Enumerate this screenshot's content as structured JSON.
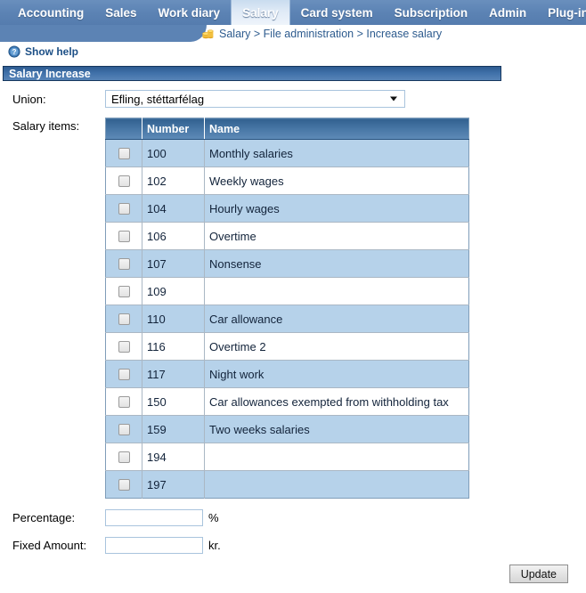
{
  "nav": {
    "items": [
      {
        "label": "Accounting",
        "active": false
      },
      {
        "label": "Sales",
        "active": false
      },
      {
        "label": "Work diary",
        "active": false
      },
      {
        "label": "Salary",
        "active": true
      },
      {
        "label": "Card system",
        "active": false
      },
      {
        "label": "Subscription",
        "active": false
      },
      {
        "label": "Admin",
        "active": false
      },
      {
        "label": "Plug-ins",
        "active": false
      }
    ]
  },
  "breadcrumb": {
    "icon": "coin-stack-icon",
    "text": "Salary > File administration > Increase salary"
  },
  "help": {
    "icon": "question-mark-icon",
    "label": "Show help"
  },
  "panel": {
    "title": "Salary Increase"
  },
  "union": {
    "label": "Union:",
    "selected": "Efling, stéttarfélag"
  },
  "salary_items": {
    "label": "Salary items:",
    "columns": [
      "",
      "Number",
      "Name"
    ],
    "rows": [
      {
        "number": "100",
        "name": "Monthly salaries",
        "checked": false
      },
      {
        "number": "102",
        "name": "Weekly wages",
        "checked": false
      },
      {
        "number": "104",
        "name": "Hourly wages",
        "checked": false
      },
      {
        "number": "106",
        "name": "Overtime",
        "checked": false
      },
      {
        "number": "107",
        "name": "Nonsense",
        "checked": false
      },
      {
        "number": "109",
        "name": "",
        "checked": false
      },
      {
        "number": "110",
        "name": "Car allowance",
        "checked": false
      },
      {
        "number": "116",
        "name": "Overtime 2",
        "checked": false
      },
      {
        "number": "117",
        "name": "Night work",
        "checked": false
      },
      {
        "number": "150",
        "name": "Car allowances exempted from withholding tax",
        "checked": false
      },
      {
        "number": "159",
        "name": "Two weeks salaries",
        "checked": false
      },
      {
        "number": "194",
        "name": "",
        "checked": false
      },
      {
        "number": "197",
        "name": "",
        "checked": false
      }
    ]
  },
  "percentage": {
    "label": "Percentage:",
    "value": "",
    "placeholder": "",
    "suffix": "%"
  },
  "fixed_amount": {
    "label": "Fixed Amount:",
    "value": "",
    "placeholder": "",
    "suffix": "kr."
  },
  "update_button": {
    "label": "Update"
  },
  "colors": {
    "nav_bg": "#5c83b4",
    "panel_title_bg": "#3f70a8",
    "table_header_bg": "#4877a6",
    "row_odd_bg": "#b6d2ea",
    "row_even_bg": "#ffffff",
    "breadcrumb_text": "#2d5b8e",
    "help_text": "#1c4f86"
  }
}
